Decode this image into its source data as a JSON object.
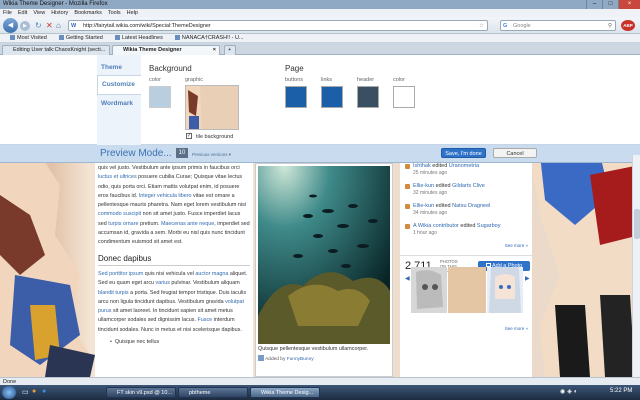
{
  "browser": {
    "title": "Wikia Theme Designer - Mozilla Firefox",
    "menu": [
      "File",
      "Edit",
      "View",
      "History",
      "Bookmarks",
      "Tools",
      "Help"
    ],
    "url": "http://fairytail.wikia.com/wiki/Special:ThemeDesigner",
    "search_placeholder": "Google",
    "bookmarks": [
      "Most Visited",
      "Getting Started",
      "Latest Headlines",
      "NANACA†CRASH!! - U..."
    ],
    "tabs": [
      "Editing User talk:ChaosKnight (secti...",
      "Wikia Theme Designer"
    ],
    "status": "Done"
  },
  "designer": {
    "nav": [
      "Theme",
      "Customize",
      "Wordmark"
    ],
    "background_title": "Background",
    "page_title": "Page",
    "color_label": "color",
    "graphic_label": "graphic",
    "tile_label": "tile background",
    "buttons_label": "buttons",
    "links_label": "links",
    "header_label": "header",
    "colors": {
      "bg": "#b9cfe0",
      "buttons": "#1b5fa8",
      "links": "#1b5fa8",
      "header": "#3a4f61",
      "page": "#ffffff"
    }
  },
  "preview": {
    "title": "Preview Mode...",
    "version": "10",
    "previous": "Previous versions",
    "save": "Save, I'm done",
    "cancel": "Cancel"
  },
  "article": {
    "p1_parts": [
      "quis vel justo. Vestibulum ante ipsum primis in faucibus orci ",
      "luctus et ultrices",
      " posuere cubilia Curae; Quisque vitae lectus odio, quis porta orci. Etiam mattis volutpat enim, id posuere eros faucibus id. ",
      "Integer vehicula libero",
      " vitae est ornare a pellentesque mauris pharetra. Nam eget lorem vestibulum nisi ",
      "commodo suscipit",
      " non sit amet justo. Fusce imperdiet lacus sed ",
      "turpis ornare",
      " pretium. ",
      "Maecenas ante neque",
      ", imperdiet sed accumsan id, gravida a sem. Morbi eu nisl quis nunc tincidunt condimentum euismod sit amet est."
    ],
    "heading": "Donec dapibus",
    "p2_parts": [
      "Sed porttitor ipsum",
      " quis nisi vehicula vel ",
      "auctor magna",
      " aliquet. Sed eu quam eget arcu ",
      "varius",
      " pulvinar. Vestibulum aliquam ",
      "blandit turpis",
      " a porta. Sed feugiat tempor tristique. Duis iaculis arcu non ligula tincidunt dapibus. Vestibulum gravida ",
      "volutpat purus",
      " sit amet laoreet. In tincidunt sapien sit amet metus ullamcorper sodales sed dignissim lacus. ",
      "Fusce",
      " interdum tincidunt sodales. Nunc in metus et nisi scelerisque dapibus."
    ],
    "bullet": "Quisque nec tellus"
  },
  "photo": {
    "caption": "Quisque pellentesque vestibulum ullamcorper.",
    "added_by": "Added by",
    "user": "FunnyBunny"
  },
  "activity": [
    {
      "user": "Ishthak",
      "action": "edited",
      "page": "Uranometria",
      "time": "25 minutes ago"
    },
    {
      "user": "Ellie-kun",
      "action": "edited",
      "page": "Gildarts Clive",
      "time": "32 minutes ago"
    },
    {
      "user": "Ellie-kun",
      "action": "edited",
      "page": "Natsu Dragneel",
      "time": "34 minutes ago"
    },
    {
      "user": "A Wikia contributor",
      "action": "edited",
      "page": "Sugarboy",
      "time": "1 hour ago"
    }
  ],
  "rail": {
    "see_more": "See more »",
    "photo_count": "2,711",
    "photo_label_1": "PHOTOS",
    "photo_label_2": "ON THIS",
    "photo_label_3": "WIKI",
    "add_photo": "Add a Photo"
  },
  "taskbar": {
    "items": [
      "FT skin v9.psd @ 10...",
      "pbtheme",
      "Wikia Theme Desig..."
    ],
    "clock": "5:22 PM"
  }
}
